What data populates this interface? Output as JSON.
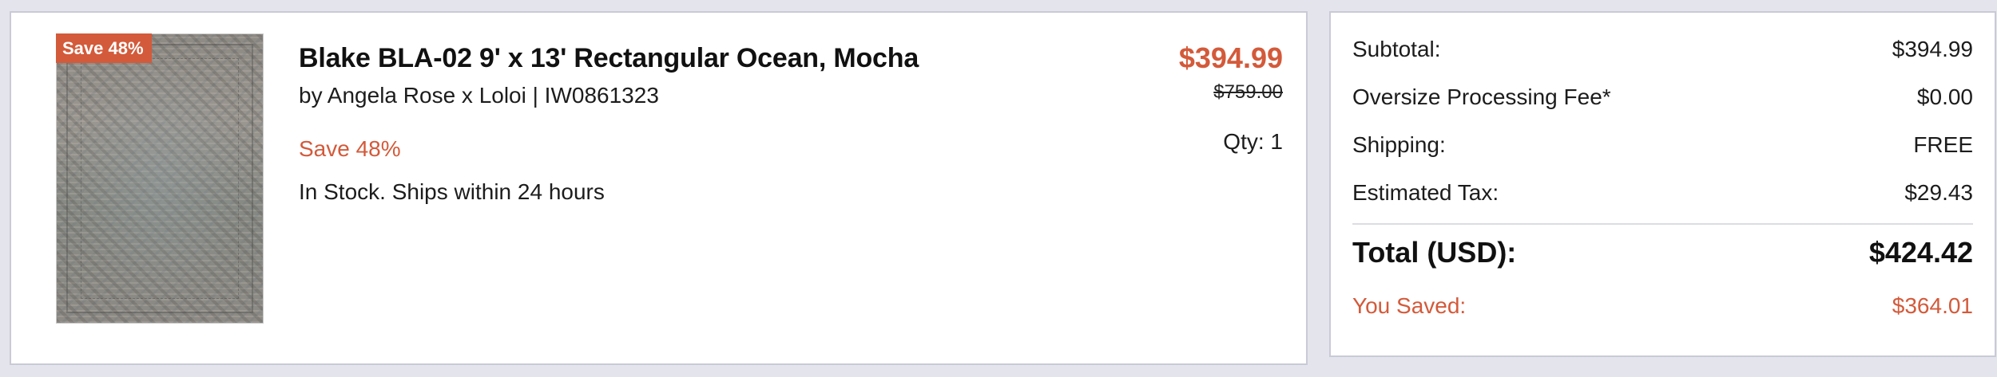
{
  "item": {
    "badge": "Save 48%",
    "image_alt": "Blake BLA-02 rug",
    "title": "Blake BLA-02 9' x 13' Rectangular Ocean, Mocha",
    "byline": "by Angela Rose x Loloi | IW0861323",
    "savings_text": "Save 48%",
    "stock_text": "In Stock. Ships within 24 hours",
    "price": "$394.99",
    "original_price": "$759.00",
    "qty": "Qty: 1"
  },
  "summary": {
    "subtotal_label": "Subtotal:",
    "subtotal_value": "$394.99",
    "oversize_label": "Oversize Processing Fee*",
    "oversize_value": "$0.00",
    "shipping_label": "Shipping:",
    "shipping_value": "FREE",
    "tax_label": "Estimated Tax:",
    "tax_value": "$29.43",
    "total_label": "Total (USD):",
    "total_value": "$424.42",
    "saved_label": "You Saved:",
    "saved_value": "$364.01"
  },
  "colors": {
    "accent": "#d35a3a",
    "page_background": "#e4e5ec",
    "card_border": "#c9cad6"
  }
}
